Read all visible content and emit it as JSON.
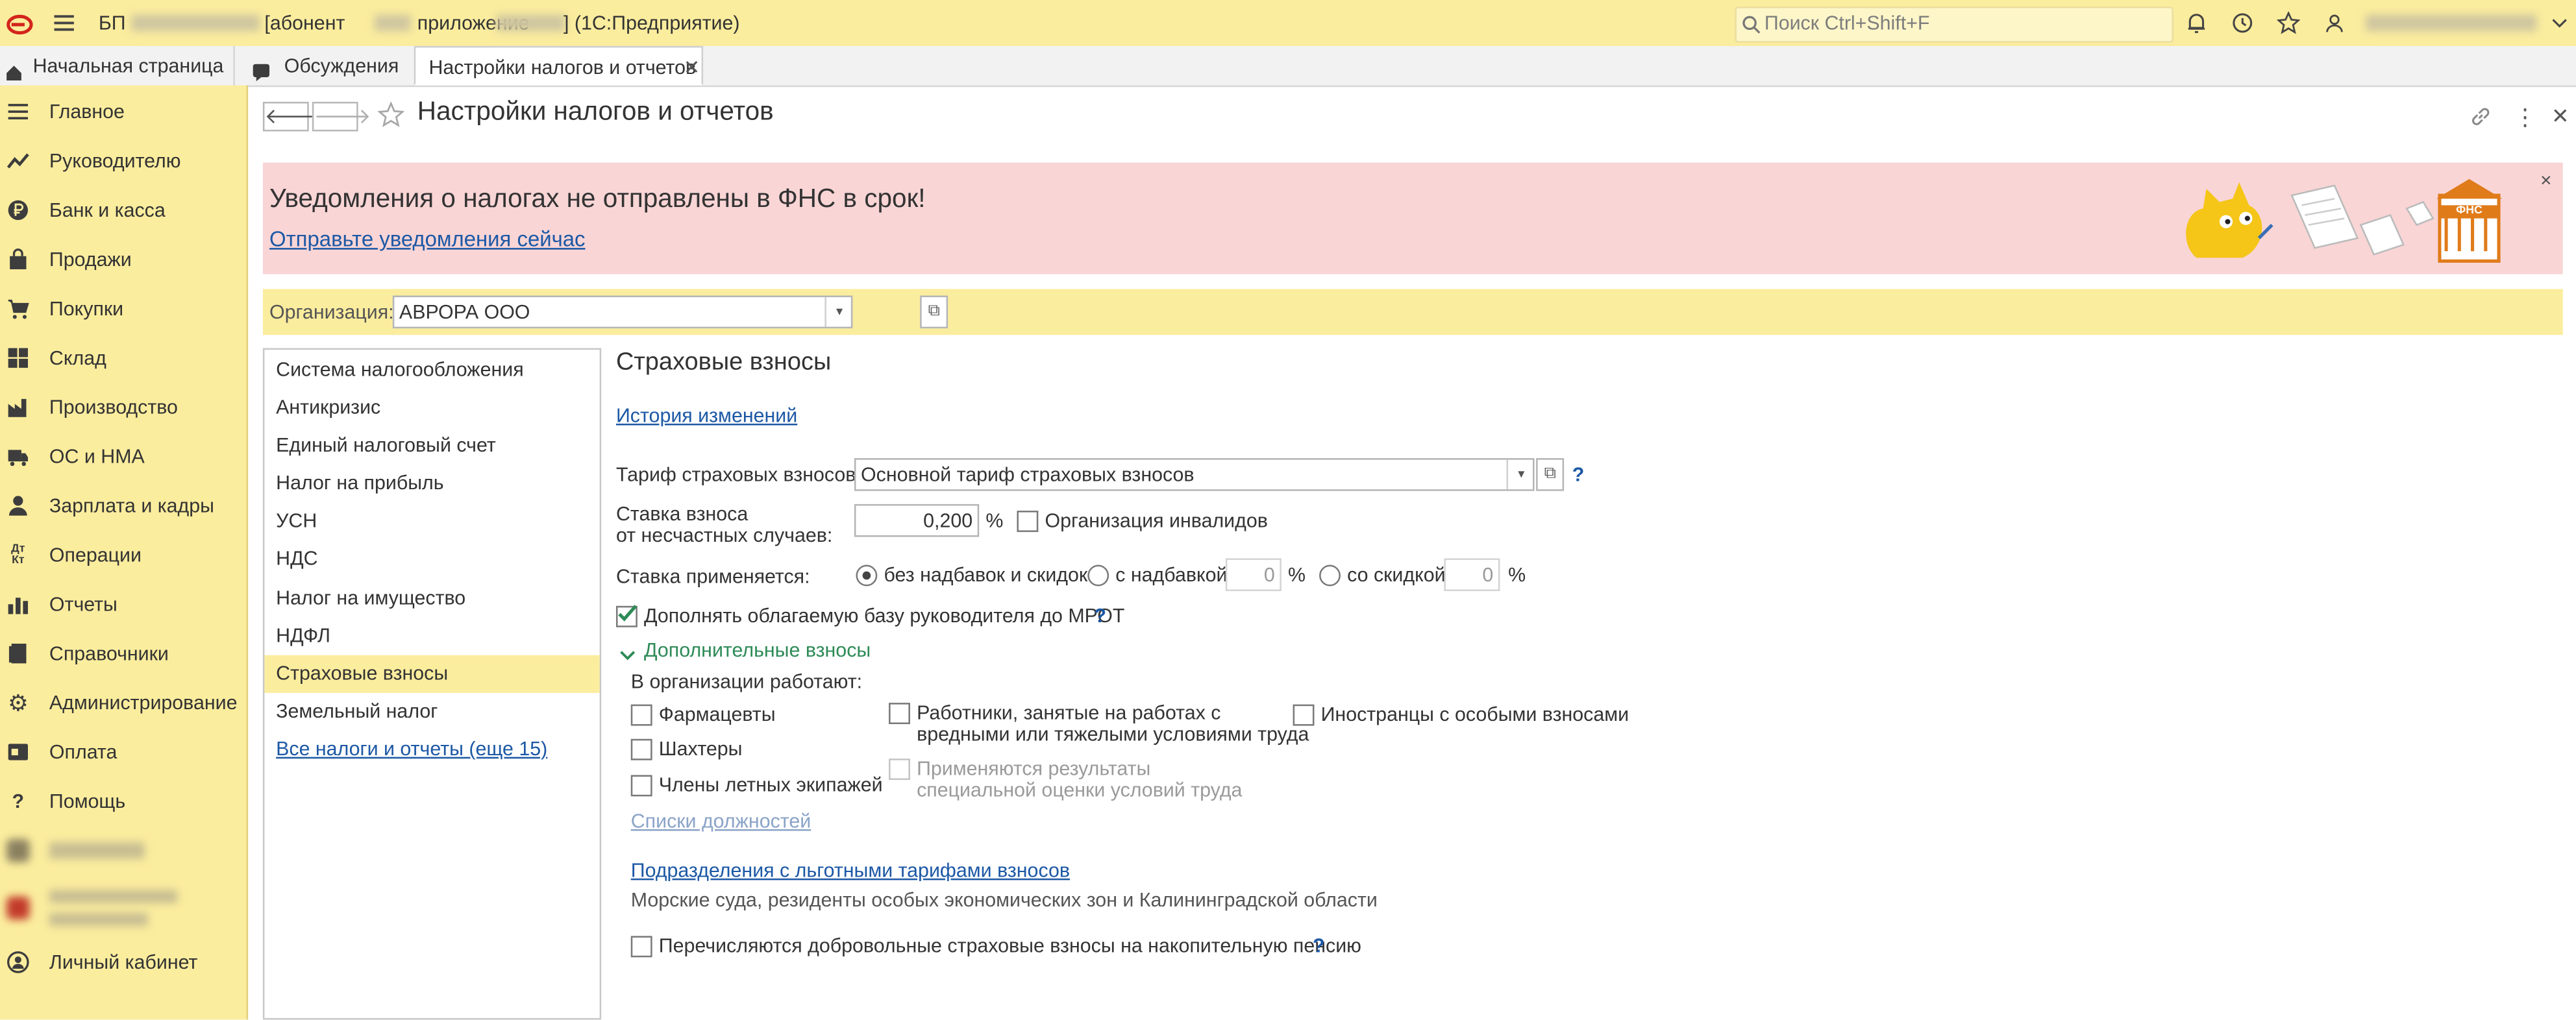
{
  "title_bar": {
    "app_prefix": "БП",
    "app_name_hidden": "                    ",
    "abonent_label": "[абонент",
    "abonent_id_hidden": "    ",
    "app_label": "приложение",
    "app_id_hidden": "        ",
    "platform": "] (1С:Предприятие)",
    "search_placeholder": "Поиск Ctrl+Shift+F",
    "user_hidden": "                           "
  },
  "tabs": [
    {
      "label": "Начальная страница"
    },
    {
      "label": "Обсуждения"
    },
    {
      "label": "Настройки налогов и отчетов"
    }
  ],
  "sidebar": {
    "items": [
      {
        "label": "Главное",
        "icon": "menu-lines-icon"
      },
      {
        "label": "Руководителю",
        "icon": "trend-up-icon"
      },
      {
        "label": "Банк и касса",
        "icon": "ruble-coin-icon"
      },
      {
        "label": "Продажи",
        "icon": "shopping-bag-icon"
      },
      {
        "label": "Покупки",
        "icon": "cart-icon"
      },
      {
        "label": "Склад",
        "icon": "warehouse-grid-icon"
      },
      {
        "label": "Производство",
        "icon": "factory-icon"
      },
      {
        "label": "ОС и НМА",
        "icon": "truck-icon"
      },
      {
        "label": "Зарплата и кадры",
        "icon": "person-icon"
      },
      {
        "label": "Операции",
        "icon": "debit-credit-icon"
      },
      {
        "label": "Отчеты",
        "icon": "bar-chart-icon"
      },
      {
        "label": "Справочники",
        "icon": "book-icon"
      },
      {
        "label": "Администрирование",
        "icon": "gear-icon"
      },
      {
        "label": "Оплата",
        "icon": "payment-icon"
      },
      {
        "label": "Помощь",
        "icon": "question-icon"
      }
    ],
    "hidden_items": [
      {
        "label": "            "
      },
      {
        "label": "                "
      }
    ],
    "account": {
      "label": "Личный кабинет",
      "icon": "user-circle-icon"
    }
  },
  "form": {
    "title": "Настройки налогов и отчетов",
    "notification": {
      "title": "Уведомления о налогах не отправлены в ФНС в срок!",
      "link": "Отправьте уведомления сейчас",
      "badge": "ФНС"
    },
    "organization": {
      "label": "Организация:",
      "value": "АВРОРА ООО"
    },
    "left_nav": {
      "items": [
        {
          "label": "Система налогообложения"
        },
        {
          "label": "Антикризис"
        },
        {
          "label": "Единый налоговый счет"
        },
        {
          "label": "Налог на прибыль"
        },
        {
          "label": "УСН"
        },
        {
          "label": "НДС"
        },
        {
          "label": "Налог на имущество"
        },
        {
          "label": "НДФЛ"
        },
        {
          "label": "Страховые взносы"
        },
        {
          "label": "Земельный налог"
        }
      ],
      "all_link": "Все налоги и отчеты (еще 15)",
      "selected": "Страховые взносы"
    },
    "section": {
      "title": "Страховые взносы",
      "history_link": "История изменений",
      "tariff_label": "Тариф страховых взносов:",
      "tariff_value": "Основной тариф страховых взносов",
      "help": "?",
      "accident_rate_label_1": "Ставка взноса",
      "accident_rate_label_2": "от несчастных случаев:",
      "accident_rate_value": "0,200",
      "percent": "%",
      "disabled_org_label": "Организация инвалидов",
      "rate_applies_label": "Ставка применяется:",
      "rate_options": [
        {
          "label": "без надбавок и скидок",
          "selected": true
        },
        {
          "label": "с надбавкой",
          "selected": false,
          "value": "0"
        },
        {
          "label": "со скидкой",
          "selected": false,
          "value": "0"
        }
      ],
      "mrot_label": "Дополнять облагаемую базу руководителя до МРОТ",
      "mrot_checked": true,
      "additional_title": "Дополнительные взносы",
      "work_in_org_label": "В организации работают:",
      "workers": {
        "pharmacists": "Фармацевты",
        "miners": "Шахтеры",
        "flight_crew": "Члены летных экипажей",
        "hazardous_1": "Работники, занятые на работах с",
        "hazardous_2": "вредными или тяжелыми условиями труда",
        "results_1": "Применяются результаты",
        "results_2": "специальной оценки условий труда",
        "foreigners": "Иностранцы с особыми взносами"
      },
      "positions_link": "Списки должностей",
      "subdivisions_link": "Подразделения с льготными тарифами взносов",
      "subdivisions_note": "Морские суда, резиденты особых экономических зон и Калининградской области",
      "voluntary_label": "Перечисляются добровольные страховые взносы на накопительную пенсию"
    }
  },
  "colors": {
    "panel_yellow": "#fbed9e",
    "notification_pink": "#f9d5d6",
    "link_blue": "#1c58a5",
    "selected_nav": "#fbed9e",
    "accent_green": "#2e8b57"
  }
}
